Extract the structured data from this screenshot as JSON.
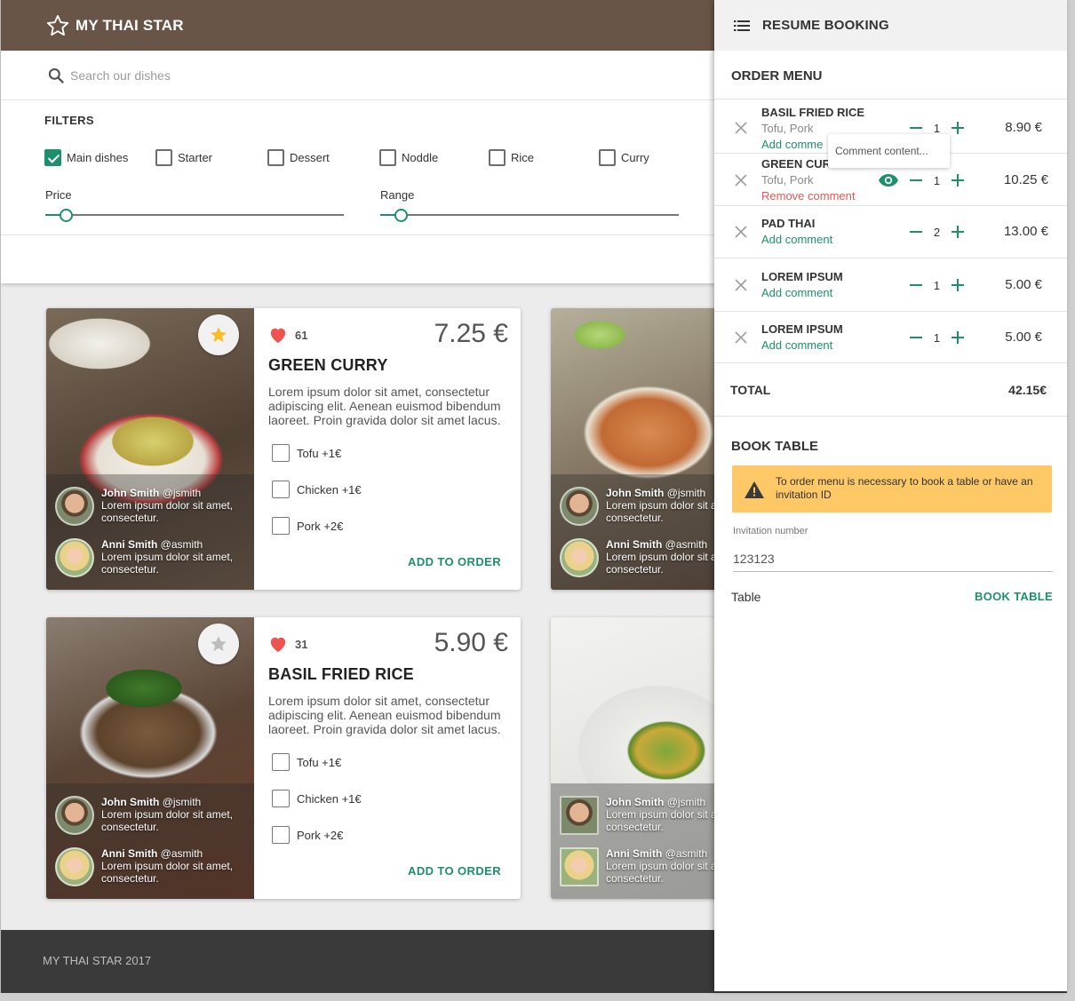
{
  "app": {
    "title": "MY THAI STAR"
  },
  "search": {
    "placeholder": "Search our dishes"
  },
  "filters": {
    "title": "FILTERS",
    "categories": [
      {
        "label": "Main dishes",
        "checked": true
      },
      {
        "label": "Starter",
        "checked": false
      },
      {
        "label": "Dessert",
        "checked": false
      },
      {
        "label": "Noddle",
        "checked": false
      },
      {
        "label": "Rice",
        "checked": false
      },
      {
        "label": "Curry",
        "checked": false
      }
    ],
    "price_label": "Price",
    "range_label": "Range",
    "price_value": 0.05,
    "range_value": 0.05
  },
  "dishes": [
    {
      "likes": "61",
      "price": "7.25 €",
      "name": "GREEN CURRY",
      "description": "Lorem ipsum dolor sit amet, consectetur adipiscing elit. Aenean euismod bibendum laoreet. Proin gravida dolor sit amet lacus.",
      "favorite": true,
      "extras": [
        "Tofu +1€",
        "Chicken +1€",
        "Pork +2€"
      ],
      "add_label": "ADD TO ORDER",
      "reviews": [
        {
          "name": "John Smith",
          "handle": "@jsmith",
          "text": "Lorem ipsum dolor sit amet, consectetur."
        },
        {
          "name": "Anni Smith",
          "handle": "@asmith",
          "text": "Lorem ipsum dolor sit amet, consectetur."
        }
      ]
    },
    {
      "likes": "31",
      "price": "5.90 €",
      "name": "BASIL FRIED RICE",
      "description": "Lorem ipsum dolor sit amet, consectetur adipiscing elit. Aenean euismod bibendum laoreet. Proin gravida dolor sit amet lacus.",
      "favorite": false,
      "extras": [
        "Tofu +1€",
        "Chicken +1€",
        "Pork +2€"
      ],
      "add_label": "ADD TO ORDER",
      "reviews": [
        {
          "name": "John Smith",
          "handle": "@jsmith",
          "text": "Lorem ipsum dolor sit amet, consectetur."
        },
        {
          "name": "Anni Smith",
          "handle": "@asmith",
          "text": "Lorem ipsum dolor sit amet, consectetur."
        }
      ]
    },
    {
      "reviews": [
        {
          "name": "John Smith",
          "handle": "@jsmith",
          "text": "Lorem ipsum dolor sit amet, consectetur."
        },
        {
          "name": "Anni Smith",
          "handle": "@asmith",
          "text": "Lorem ipsum dolor sit amet, consectetur."
        }
      ]
    },
    {
      "reviews": [
        {
          "name": "John Smith",
          "handle": "@jsmith",
          "text": "Lorem ipsum dolor sit amet, consectetur."
        },
        {
          "name": "Anni Smith",
          "handle": "@asmith",
          "text": "Lorem ipsum dolor sit amet, consectetur."
        }
      ]
    }
  ],
  "footer": {
    "text": "MY THAI STAR 2017"
  },
  "panel": {
    "title": "RESUME BOOKING",
    "order_title": "ORDER MENU",
    "orders": [
      {
        "name": "BASIL FRIED RICE",
        "sub": "Tofu, Pork",
        "comment": "Add comme",
        "qty": "1",
        "price": "8.90 €"
      },
      {
        "name": "GREEN CUR",
        "sub": "Tofu, Pork",
        "comment": "Remove comment",
        "qty": "1",
        "price": "10.25 €"
      },
      {
        "name": "PAD THAI",
        "sub": "",
        "comment": "Add comment",
        "qty": "2",
        "price": "13.00 €"
      },
      {
        "name": "LOREM IPSUM",
        "sub": "",
        "comment": "Add comment",
        "qty": "1",
        "price": "5.00 €"
      },
      {
        "name": "LOREM IPSUM",
        "sub": "",
        "comment": "Add comment",
        "qty": "1",
        "price": "5.00 €"
      }
    ],
    "tooltip": "Comment content...",
    "total_label": "TOTAL",
    "total_value": "42.15€",
    "book_title": "BOOK TABLE",
    "warning": "To order menu is necessary to book a table or have an invitation ID",
    "invitation_label": "Invitation number",
    "invitation_value": "123123",
    "table_label": "Table",
    "book_button": "BOOK TABLE"
  },
  "colors": {
    "brand_bar": "#685547",
    "accent": "#1e8f6e",
    "warning": "#fdc865",
    "remove": "#e35858",
    "heart": "#ef5350",
    "star": "#f7bd2a"
  }
}
